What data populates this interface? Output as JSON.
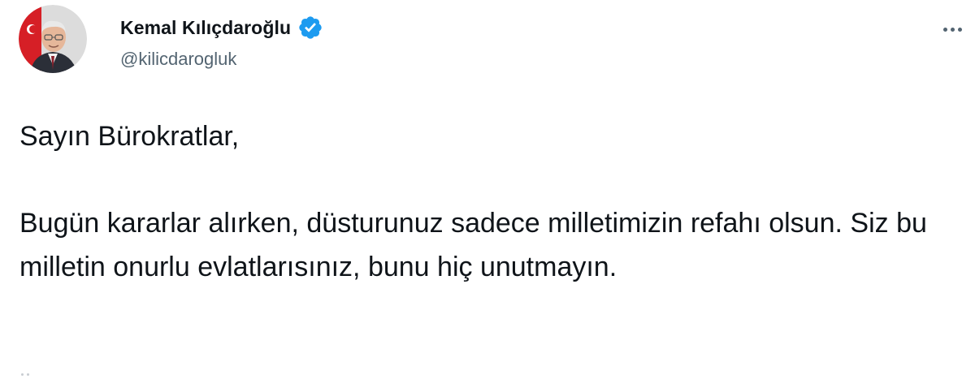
{
  "tweet": {
    "author": {
      "display_name": "Kemal Kılıçdaroğlu",
      "handle": "@kilicdarogluk",
      "verified": true,
      "verified_color": "#1d9bf0",
      "avatar_icon": "profile-photo"
    },
    "more_icon": "more-options-icon",
    "text": "Sayın Bürokratlar,\n\nBugün kararlar alırken, düsturunuz sadece milletimizin refahı olsun. Siz bu milletin onurlu evlatlarısınız, bunu hiç unutmayın."
  },
  "colors": {
    "text_primary": "#0f1419",
    "text_secondary": "#536471",
    "background": "#ffffff",
    "accent": "#1d9bf0"
  }
}
